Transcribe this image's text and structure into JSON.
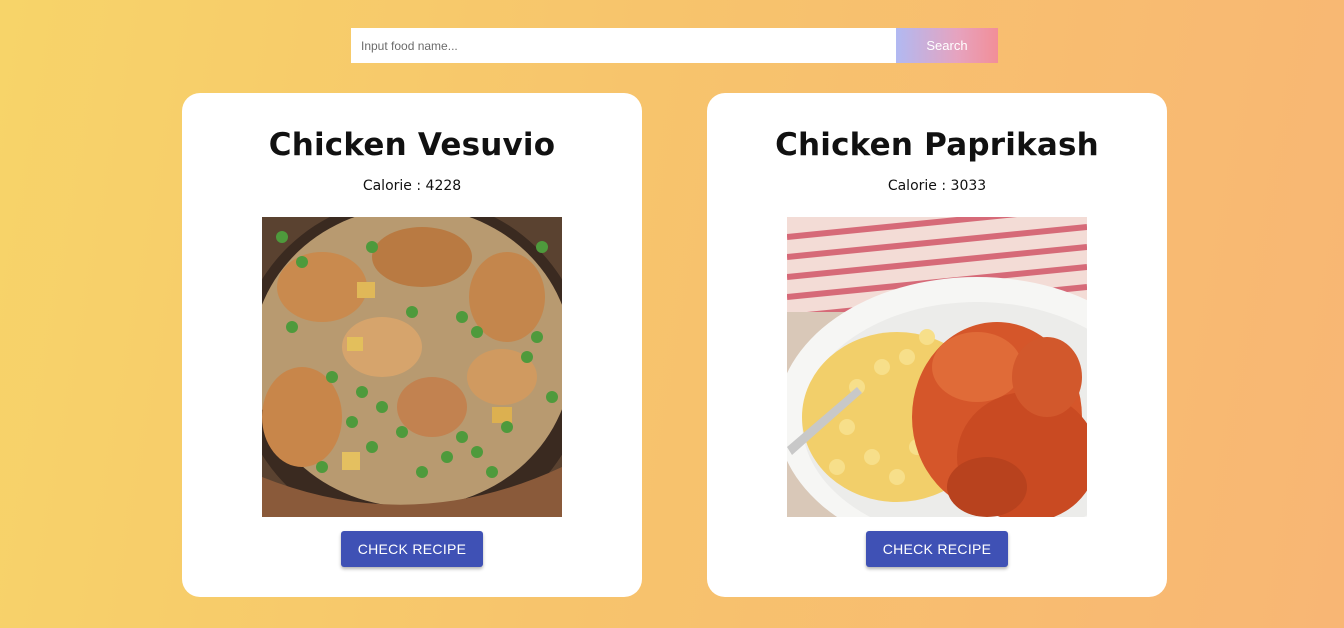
{
  "search": {
    "placeholder": "Input food name...",
    "value": "",
    "button_label": "Search"
  },
  "recipes": [
    {
      "title": "Chicken Vesuvio",
      "calorie_label": "Calorie :",
      "calorie_value": "4228",
      "image": "chicken-vesuvio-photo",
      "button_label": "CHECK RECIPE"
    },
    {
      "title": "Chicken Paprikash",
      "calorie_label": "Calorie :",
      "calorie_value": "3033",
      "image": "chicken-paprikash-photo",
      "button_label": "CHECK RECIPE"
    }
  ],
  "colors": {
    "background_start": "#f7d469",
    "background_end": "#f8b674",
    "button": "#3f51b5",
    "search_button_start": "#b1b9f2",
    "search_button_end": "#f28e98"
  }
}
